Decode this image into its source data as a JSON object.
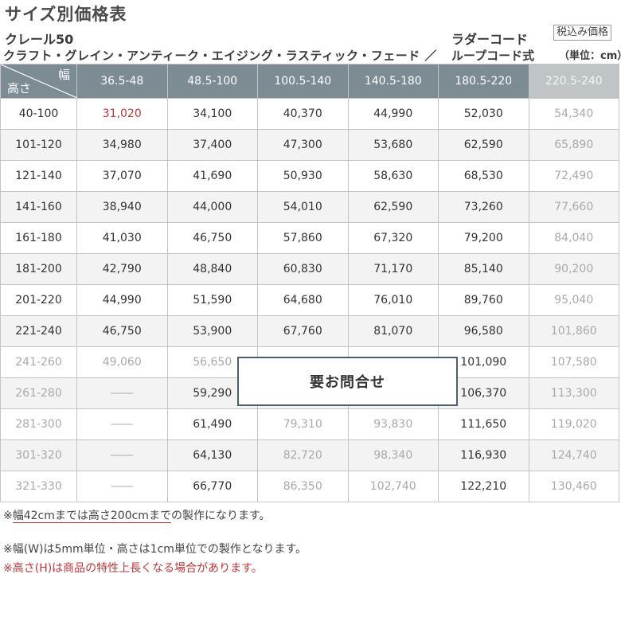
{
  "header": {
    "title": "サイズ別価格表",
    "product": "クレール50",
    "variants": "クラフト・グレイン・アンティーク・エイジング・ラスティック・フェード ／",
    "cord_line1": "ラダーコード",
    "cord_line2": "ループコード式",
    "tax_badge": "税込み価格",
    "unit": "（単位：cm）"
  },
  "table": {
    "corner_width": "幅",
    "corner_height": "高さ",
    "columns": [
      "36.5-48",
      "48.5-100",
      "100.5-140",
      "140.5-180",
      "180.5-220",
      "220.5-240"
    ],
    "rows": [
      {
        "height": "40-100",
        "cells": [
          "31,020",
          "34,100",
          "40,370",
          "44,990",
          "52,030",
          "54,340"
        ]
      },
      {
        "height": "101-120",
        "cells": [
          "34,980",
          "37,400",
          "47,300",
          "53,680",
          "62,590",
          "65,890"
        ]
      },
      {
        "height": "121-140",
        "cells": [
          "37,070",
          "41,690",
          "50,930",
          "58,630",
          "68,530",
          "72,490"
        ]
      },
      {
        "height": "141-160",
        "cells": [
          "38,940",
          "44,000",
          "54,010",
          "62,590",
          "73,260",
          "77,660"
        ]
      },
      {
        "height": "161-180",
        "cells": [
          "41,030",
          "46,750",
          "57,860",
          "67,320",
          "79,200",
          "84,040"
        ]
      },
      {
        "height": "181-200",
        "cells": [
          "42,790",
          "48,840",
          "60,830",
          "71,170",
          "85,140",
          "90,200"
        ]
      },
      {
        "height": "201-220",
        "cells": [
          "44,990",
          "51,590",
          "64,680",
          "76,010",
          "89,760",
          "95,040"
        ]
      },
      {
        "height": "221-240",
        "cells": [
          "46,750",
          "53,900",
          "67,760",
          "81,070",
          "96,580",
          "101,860"
        ]
      },
      {
        "height": "241-260",
        "cells": [
          "49,060",
          "56,650",
          "",
          "",
          "101,090",
          "107,580"
        ]
      },
      {
        "height": "261-280",
        "cells": [
          "――",
          "59,290",
          "",
          "",
          "106,370",
          "113,300"
        ]
      },
      {
        "height": "281-300",
        "cells": [
          "――",
          "61,490",
          "79,310",
          "93,830",
          "111,650",
          "119,020"
        ]
      },
      {
        "height": "301-320",
        "cells": [
          "――",
          "64,130",
          "82,720",
          "98,340",
          "116,930",
          "124,740"
        ]
      },
      {
        "height": "321-330",
        "cells": [
          "――",
          "66,770",
          "86,350",
          "102,740",
          "122,210",
          "130,460"
        ]
      }
    ],
    "inquiry_label": "要お問合せ"
  },
  "notes": {
    "note1_mark": "※",
    "note1_underlined": "幅42cmまでは高さ200cmまで",
    "note1_rest": "の製作になります。",
    "note2": "※幅(W)は5mm単位・高さは1cm単位での製作となります。",
    "note3": "※高さ(H)は商品の特性上長くなる場合があります。"
  },
  "colors": {
    "header_bg": "#7d8b92",
    "header_last_bg": "#bfc4c7",
    "faded_text": "#a9a9a9",
    "accent_red": "#c0353a",
    "inquiry_border": "#4a5f6a"
  }
}
